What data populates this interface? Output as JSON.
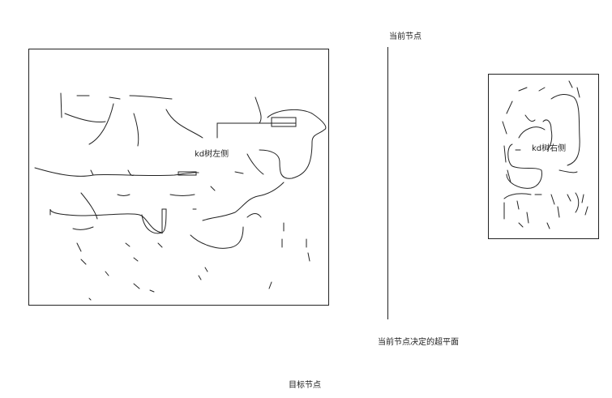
{
  "labels": {
    "current_node": "当前节点",
    "kd_left": "kd树左侧",
    "kd_right": "kd树右侧",
    "hyperplane": "当前节点决定的超平面",
    "target_node": "目标节点"
  },
  "colors": {
    "ink": "#222222",
    "background": "#ffffff"
  }
}
